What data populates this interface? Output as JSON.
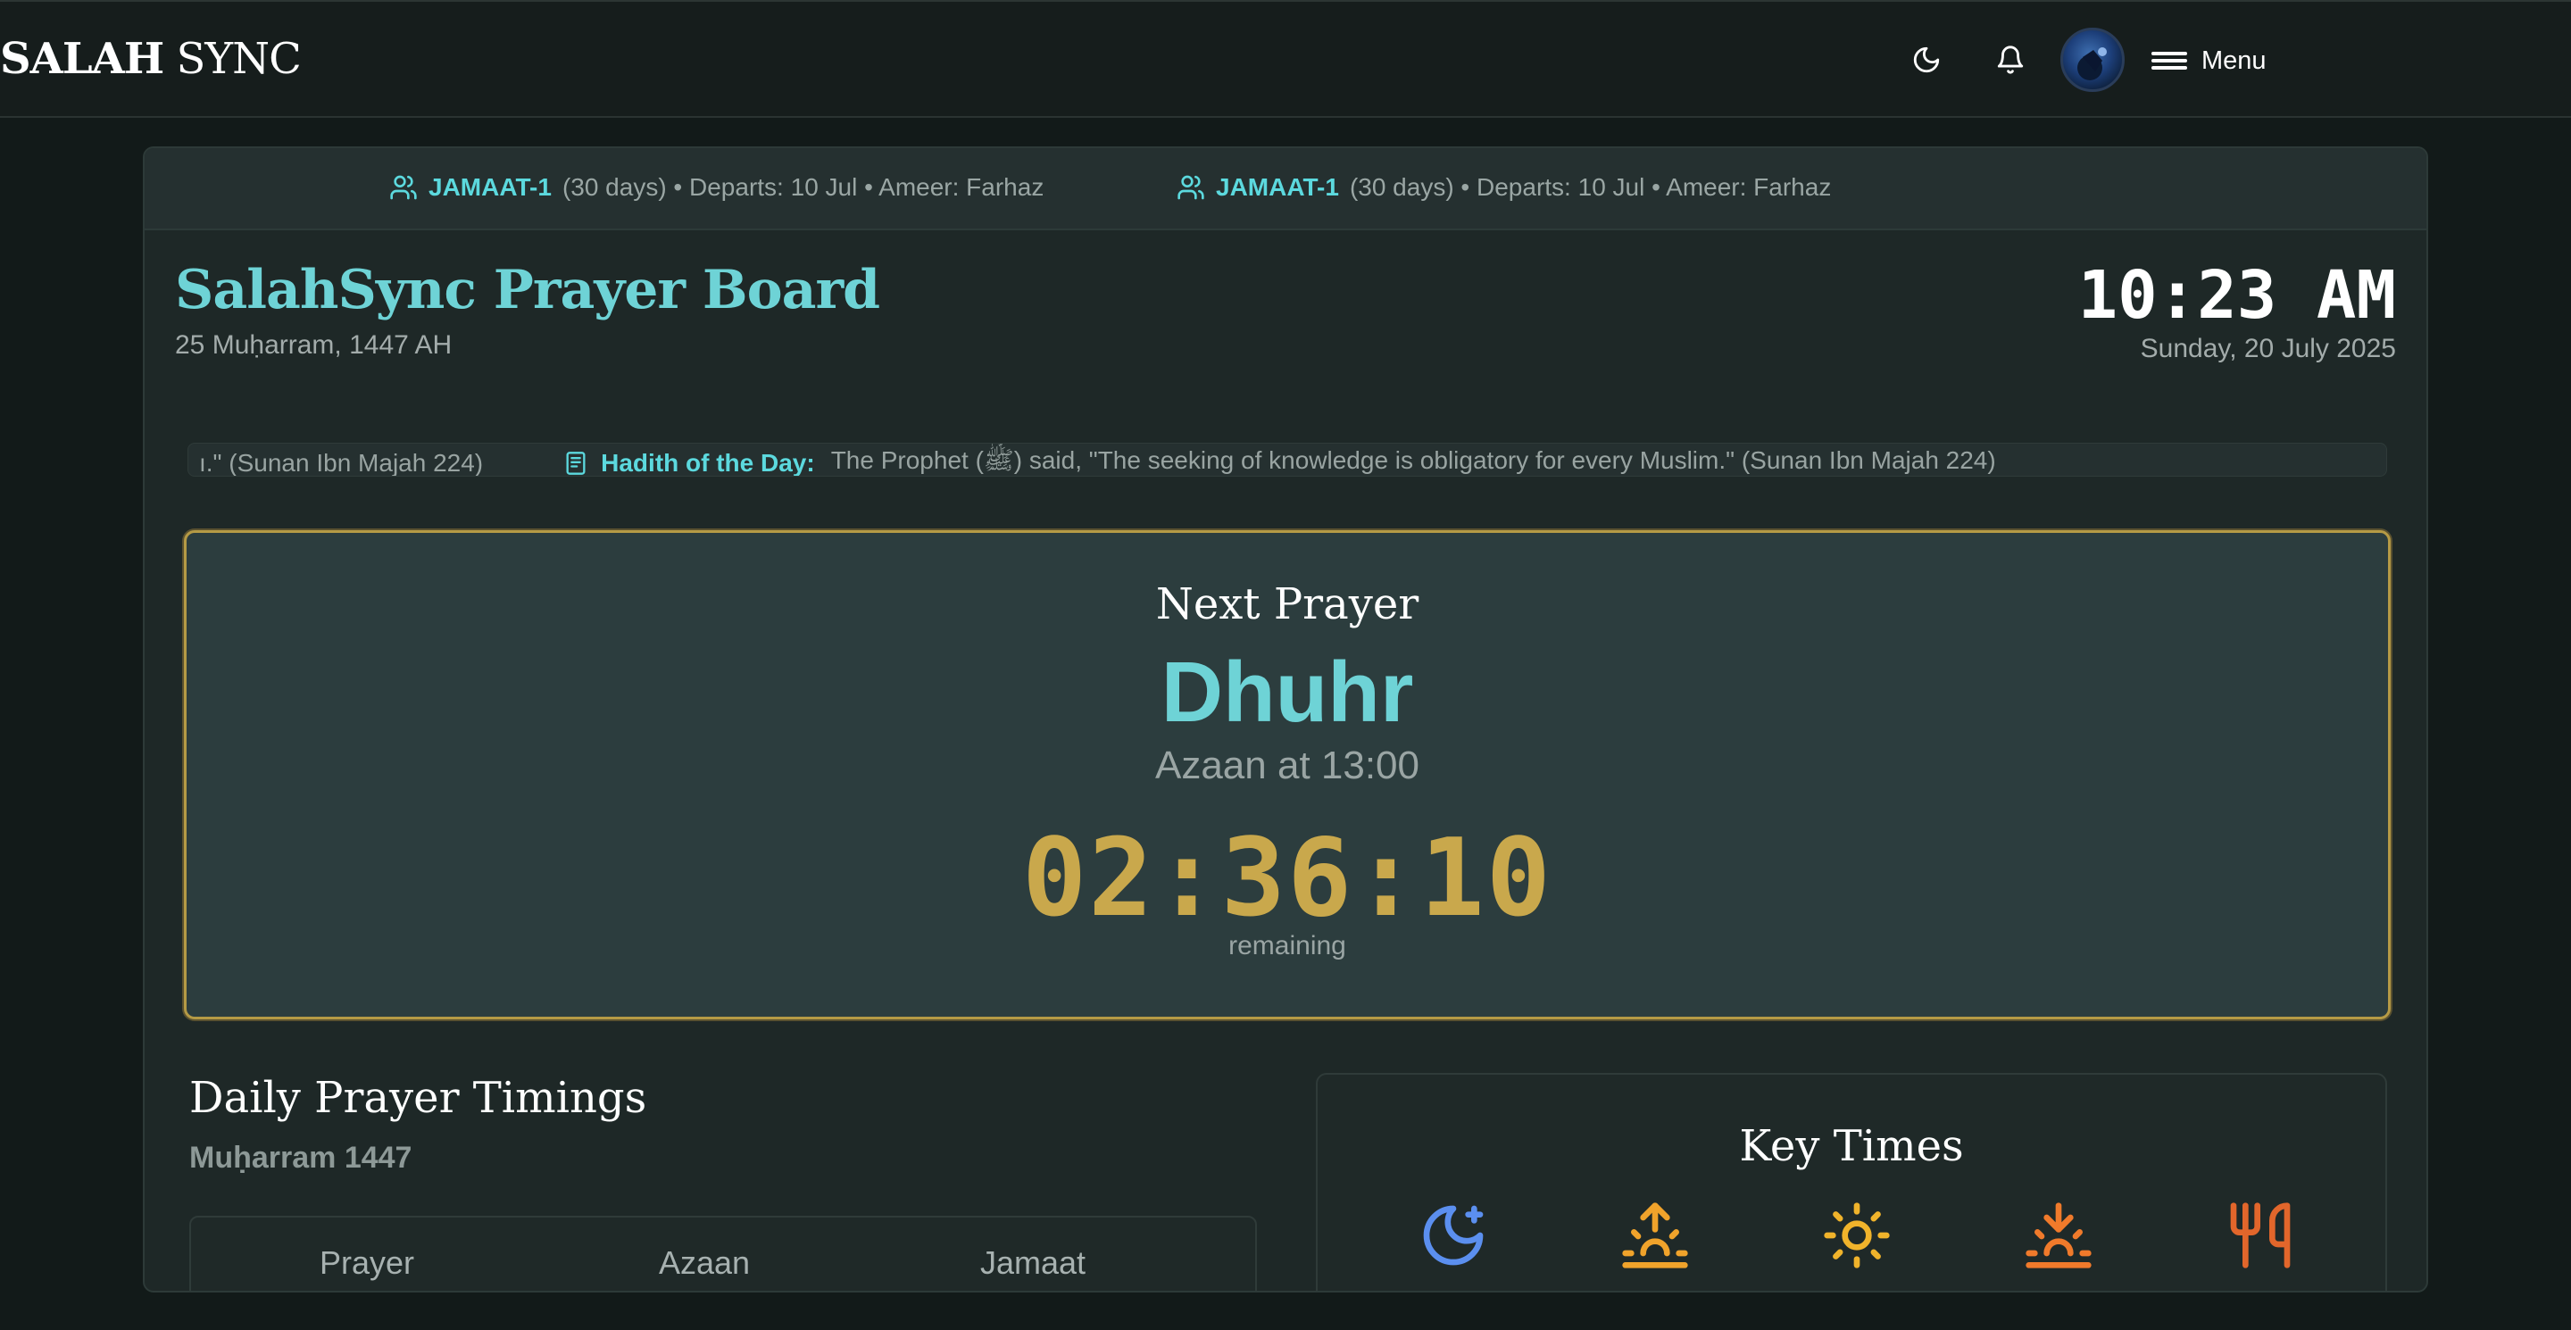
{
  "app": {
    "brand_bold": "SALAH",
    "brand_light": "SYNC",
    "menu_label": "Menu"
  },
  "banner": {
    "items": [
      {
        "tag": "JAMAAT-1",
        "detail": "(30 days) • Departs: 10 Jul • Ameer: Farhaz"
      },
      {
        "tag": "JAMAAT-1",
        "detail": "(30 days) • Departs: 10 Jul • Ameer: Farhaz"
      }
    ]
  },
  "header": {
    "title": "SalahSync Prayer Board",
    "hijri_date": "25 Muḥarram, 1447 AH",
    "time": "10:23 AM",
    "gregorian_date": "Sunday, 20 July 2025"
  },
  "ticker": {
    "leading_fragment": "ı.\" (Sunan Ibn Majah 224)",
    "label": "Hadith of the Day:",
    "text": "The Prophet (ﷺ) said, \"The seeking of knowledge is obligatory for every Muslim.\" (Sunan Ibn Majah 224)"
  },
  "next_prayer": {
    "heading": "Next Prayer",
    "name": "Dhuhr",
    "azaan": "Azaan at 13:00",
    "countdown": "02:36:10",
    "remaining_label": "remaining"
  },
  "daily": {
    "title": "Daily Prayer Timings",
    "month": "Muḥarram 1447",
    "columns": [
      "Prayer",
      "Azaan",
      "Jamaat"
    ]
  },
  "key_times": {
    "title": "Key Times",
    "icons": [
      "moon-star-icon",
      "sunrise-icon",
      "sun-icon",
      "sunset-icon",
      "utensils-icon"
    ]
  },
  "colors": {
    "accent": "#6ed3d6",
    "gold": "#c9a84c",
    "background": "#121a19"
  }
}
